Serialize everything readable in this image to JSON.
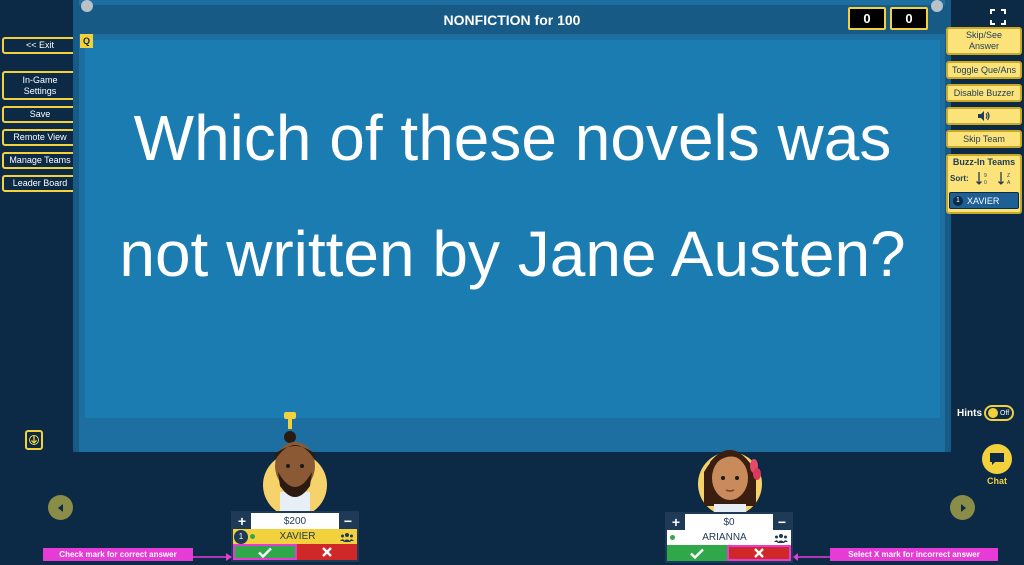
{
  "left_nav": {
    "exit": "<< Exit",
    "in_game_settings": "In-Game Settings",
    "save": "Save",
    "remote_view": "Remote View",
    "manage_teams": "Manage Teams",
    "leader_board": "Leader Board"
  },
  "board": {
    "title": "NONFICTION for 100",
    "scores": [
      "0",
      "0"
    ],
    "q_tag": "Q",
    "question": "Which of these novels was not written by Jane Austen?"
  },
  "right_panel": {
    "skip_see_answer": "Skip/See Answer",
    "toggle_que_ans": "Toggle Que/Ans",
    "disable_buzzer": "Disable Buzzer",
    "skip_team": "Skip Team",
    "buzz_in_teams": "Buzz-In Teams",
    "sort_label": "Sort:",
    "buzz_queue": [
      {
        "rank": "1",
        "name": "XAVIER"
      }
    ],
    "hints_label": "Hints",
    "hints_state": "Off",
    "chat_label": "Chat"
  },
  "players": [
    {
      "name": "XAVIER",
      "score": "$200",
      "rank": "1"
    },
    {
      "name": "ARIANNA",
      "score": "$0"
    }
  ],
  "callouts": {
    "correct": "Check mark for correct answer",
    "incorrect": "Select X mark for incorrect answer"
  },
  "colors": {
    "background": "#0c2a45",
    "board": "#1a7cb0",
    "accent_yellow": "#f2d13c",
    "correct_green": "#2fa84a",
    "incorrect_red": "#d02828",
    "callout_magenta": "#e73bd8"
  }
}
